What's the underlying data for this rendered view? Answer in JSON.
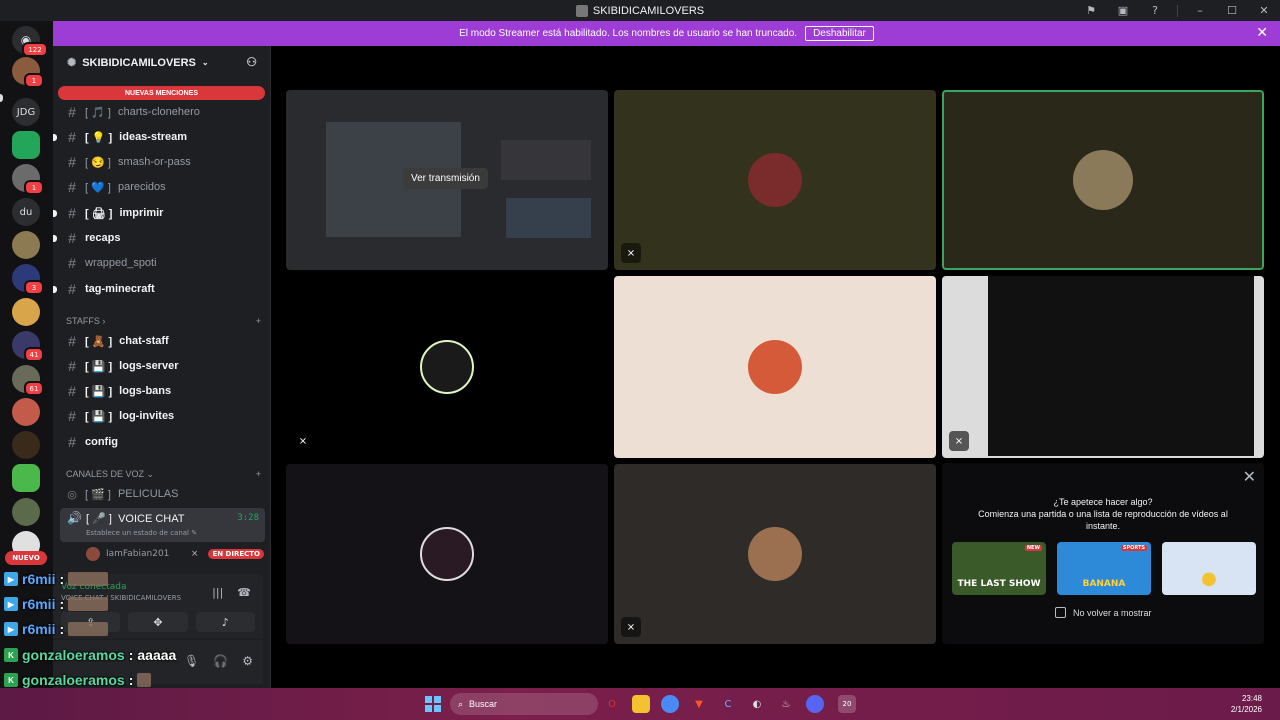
{
  "titlebar": {
    "title": "SKIBIDICAMILOVERS"
  },
  "banner": {
    "message": "El modo Streamer está habilitado. Los nombres de usuario se han truncado.",
    "button": "Deshabilitar"
  },
  "rail": {
    "dm_badge": "122",
    "items": [
      {
        "label": "",
        "badge": "1"
      },
      {
        "label": "JDG",
        "badge": ""
      },
      {
        "label": "",
        "badge": ""
      },
      {
        "label": "",
        "badge": "1"
      },
      {
        "label": "du",
        "badge": ""
      },
      {
        "label": "",
        "badge": ""
      },
      {
        "label": "",
        "badge": "3"
      },
      {
        "label": "",
        "badge": ""
      },
      {
        "label": "",
        "badge": "41"
      },
      {
        "label": "",
        "badge": "61"
      }
    ],
    "nuevo": "NUEVO"
  },
  "server": {
    "name": "SKIBIDICAMILOVERS",
    "new_mentions": "NUEVAS MENCIONES",
    "channels": [
      {
        "name": "charts-clonehero",
        "emoji": "🎵",
        "unread": false
      },
      {
        "name": "ideas-stream",
        "emoji": "💡",
        "unread": true
      },
      {
        "name": "smash-or-pass",
        "emoji": "😏",
        "unread": false
      },
      {
        "name": "parecidos",
        "emoji": "💙",
        "unread": false
      },
      {
        "name": "imprimir",
        "emoji": "🖨",
        "unread": true
      },
      {
        "name": "recaps",
        "emoji": "",
        "unread": true
      },
      {
        "name": "wrapped_spoti",
        "emoji": "",
        "unread": false
      },
      {
        "name": "tag-minecraft",
        "emoji": "",
        "unread": true
      }
    ],
    "staff_category": "STAFFS",
    "staff_channels": [
      {
        "name": "chat-staff",
        "emoji": "🧸"
      },
      {
        "name": "logs-server",
        "emoji": "💾"
      },
      {
        "name": "logs-bans",
        "emoji": "💾"
      },
      {
        "name": "log-invites",
        "emoji": "💾"
      },
      {
        "name": "config",
        "emoji": ""
      }
    ],
    "voice_category": "CANALES DE VOZ",
    "voice_channels": [
      {
        "name": "PELICULAS",
        "emoji": "🎬"
      },
      {
        "name": "VOICE CHAT",
        "emoji": "🎤",
        "time": "3:28",
        "status": "Establece un estado de canal"
      }
    ],
    "voice_user": {
      "name": "IamFabian201",
      "live": "EN DIRECTO"
    }
  },
  "voice_panel": {
    "connected": "Voz conectada",
    "location": "VOICE CHAT / SKIBIDICAMILOVERS"
  },
  "overlay": [
    {
      "name": "r6mii",
      "msg": "",
      "icon": "blue"
    },
    {
      "name": "r6mii",
      "msg": "",
      "icon": "blue"
    },
    {
      "name": "r6mii",
      "msg": "",
      "icon": "blue"
    },
    {
      "name": "gonzaloeramos",
      "msg": "aaaaa",
      "icon": "green"
    },
    {
      "name": "gonzaloeramos",
      "msg": "",
      "icon": "green"
    },
    {
      "name": "r6mii",
      "msg": "",
      "icon": "blue"
    }
  ],
  "stream": {
    "watch_button": "Ver transmisión"
  },
  "activity": {
    "question": "¿Te apetece hacer algo?",
    "subtitle": "Comienza una partida o una lista de reproducción de vídeos al instante.",
    "games": [
      {
        "name": "THE LAST SHOW",
        "tag": "NEW",
        "color": "#3b5a2a"
      },
      {
        "name": "BANANA",
        "tag": "SPORTS",
        "color": "#2c8ad9"
      },
      {
        "name": "",
        "tag": "",
        "color": "#d8e4f4"
      }
    ],
    "dont_show": "No volver a mostrar"
  },
  "taskbar": {
    "search_placeholder": "Buscar",
    "time": "23:48",
    "date": "2/1/2026",
    "discord_badge": "20"
  },
  "colors": {
    "accent": "#5865f2",
    "banner": "#9d3dd6",
    "live": "#da373c",
    "online": "#23a55a"
  }
}
